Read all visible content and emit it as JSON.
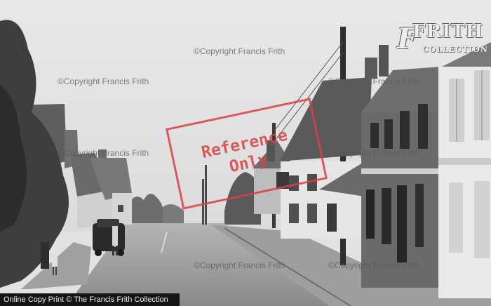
{
  "watermarks": [
    "©Copyright Francis Frith",
    "©Copyright Francis Frith",
    "©Copyright Francis Frith",
    "©Copyright Francis Frith",
    "©Copyright Francis Frith",
    "©Copyright Francis Frith",
    "©Copyright Francis Frith"
  ],
  "reference_stamp": {
    "line1": "Reference",
    "line2": "Only"
  },
  "logo": {
    "letter": "F",
    "name": "FRITH",
    "sub": "COLLECTION"
  },
  "caption": "Online Copy Print © The Francis Frith Collection",
  "colors": {
    "stamp": "#d64242",
    "caption_bar": "#141414"
  }
}
